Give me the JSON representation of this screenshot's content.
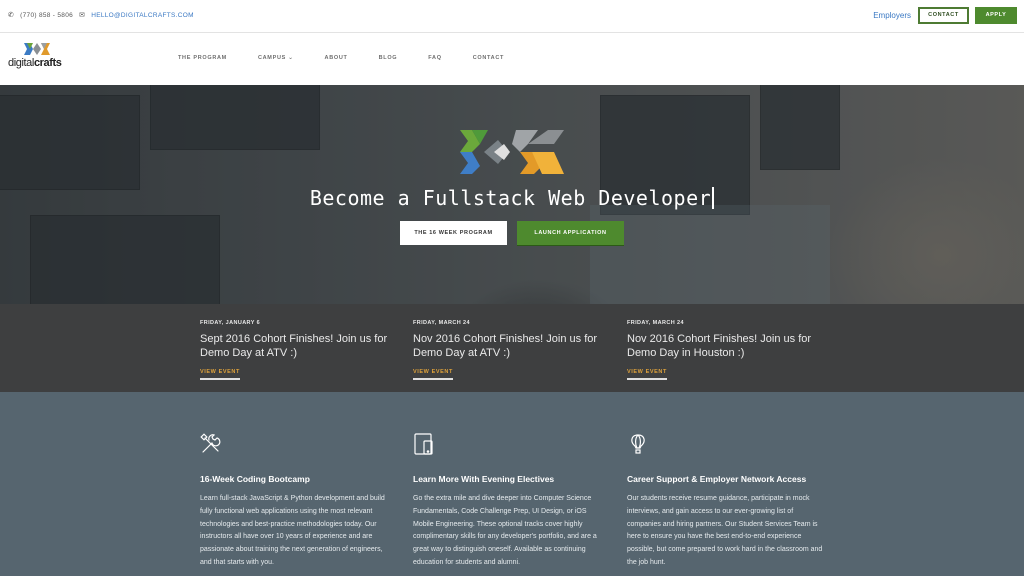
{
  "topbar": {
    "phone": "(770) 858 - 5806",
    "email": "HELLO@DIGITALCRAFTS.COM",
    "employers_link": "Employers",
    "contact_button": "CONTACT",
    "apply_button": "APPLY"
  },
  "brand": {
    "name_bold": "crafts",
    "name_light": "digital"
  },
  "nav": {
    "items": [
      {
        "label": "THE PROGRAM"
      },
      {
        "label": "CAMPUS ⌄"
      },
      {
        "label": "ABOUT"
      },
      {
        "label": "BLOG"
      },
      {
        "label": "FAQ"
      },
      {
        "label": "CONTACT"
      }
    ]
  },
  "hero": {
    "title": "Become a Fullstack Web Developer",
    "primary_button": "THE 16 WEEK PROGRAM",
    "secondary_button": "LAUNCH APPLICATION"
  },
  "events": [
    {
      "date": "FRIDAY, JANUARY 6",
      "title": "Sept 2016 Cohort Finishes! Join us for Demo Day at ATV :)",
      "link": "VIEW EVENT"
    },
    {
      "date": "FRIDAY, MARCH 24",
      "title": "Nov 2016 Cohort Finishes! Join us for Demo Day at ATV :)",
      "link": "VIEW EVENT"
    },
    {
      "date": "FRIDAY, MARCH 24",
      "title": "Nov 2016 Cohort Finishes! Join us for Demo Day in Houston :)",
      "link": "VIEW EVENT"
    }
  ],
  "features": [
    {
      "icon": "tools-icon",
      "title": "16-Week Coding Bootcamp",
      "text": "Learn full-stack JavaScript & Python development and build fully functional web applications using the most relevant technologies and best-practice methodologies today. Our instructors all have over 10 years of experience and are passionate about training the next generation of engineers, and that starts with you."
    },
    {
      "icon": "devices-icon",
      "title": "Learn More With Evening Electives",
      "text": "Go the extra mile and dive deeper into Computer Science Fundamentals, Code Challenge Prep, UI Design, or iOS Mobile Engineering. These optional tracks cover highly complimentary skills for any developer's portfolio, and are a great way to distinguish oneself. Available as continuing education for students and alumni."
    },
    {
      "icon": "balloon-icon",
      "title": "Career Support & Employer Network Access",
      "text": "Our students receive resume guidance, participate in mock interviews, and gain access to our ever-growing list of companies and hiring partners. Our Student Services Team is here to ensure you have the best end-to-end experience possible, but come prepared to work hard in the classroom and the job hunt."
    }
  ],
  "colors": {
    "accent_green": "#4e8a2e",
    "link_blue": "#3a78c3",
    "event_link": "#e0a33b",
    "features_bg": "#56656f",
    "events_bg": "#3e3f40"
  }
}
